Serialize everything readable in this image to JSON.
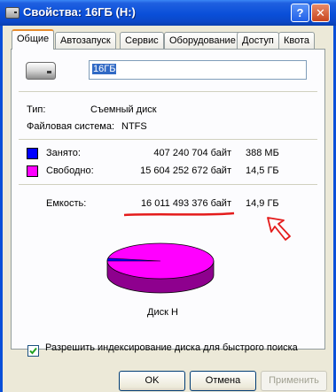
{
  "window": {
    "title": "Свойства: 16ГБ (H:)",
    "help_label": "?",
    "close_label": "✕"
  },
  "tabs": [
    {
      "label": "Общие",
      "active": true
    },
    {
      "label": "Автозапуск"
    },
    {
      "label": "Сервис"
    },
    {
      "label": "Оборудование"
    },
    {
      "label": "Доступ"
    },
    {
      "label": "Квота"
    }
  ],
  "general": {
    "drive_name": "16ГБ",
    "type_label": "Тип:",
    "type_value": "Съемный диск",
    "fs_label": "Файловая система:",
    "fs_value": "NTFS",
    "used": {
      "label": "Занято:",
      "bytes": "407 240 704 байт",
      "size": "388 МБ",
      "color": "#0000ff"
    },
    "free": {
      "label": "Свободно:",
      "bytes": "15 604 252 672 байт",
      "size": "14,5 ГБ",
      "color": "#ff00ff"
    },
    "capacity": {
      "label": "Емкость:",
      "bytes": "16 011 493 376 байт",
      "size": "14,9 ГБ"
    },
    "disk_label": "Диск H",
    "index_checkbox": {
      "label": "Разрешить индексирование диска для быстрого поиска",
      "checked": true
    }
  },
  "annotations": {
    "underline_color": "#e41b1b",
    "arrow_color": "#e41b1b"
  },
  "buttons": {
    "ok": "OK",
    "cancel": "Отмена",
    "apply": {
      "label": "Применить",
      "enabled": false
    }
  },
  "icons": {
    "title": "drive-icon",
    "drive": "removable-drive-icon"
  }
}
